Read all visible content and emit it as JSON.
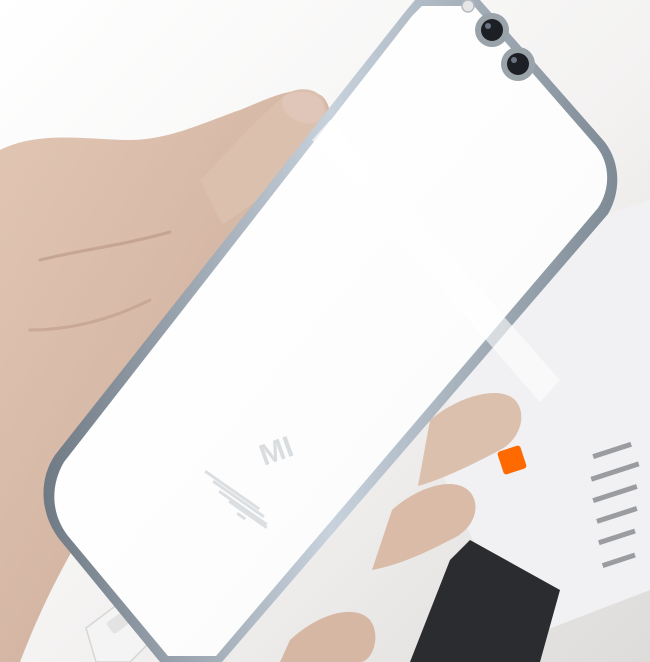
{
  "photo": {
    "subject": "phone-back-held-in-hand",
    "phone": {
      "body_color": "#fbfbfb",
      "frame_color": "#8f9aa2",
      "frame_highlight": "#c8d2dc",
      "camera_ring_color": "#9aa3aa",
      "camera_lens_color": "#1c1f24",
      "logo_text": "MI",
      "logo_color": "#d9dde0",
      "fine_print_color": "#dcdfe2"
    },
    "hand": {
      "skin_color": "#d7b9a6",
      "skin_shadow": "#b89483",
      "nail_color": "#e0c6b8"
    },
    "background": {
      "wall_color": "#e8e6e4",
      "display_card_color": "#f1f1f3",
      "brand_tag_color": "#ff6a00",
      "dark_phone_color": "#2b2c2f",
      "charger_color": "#f4f4f4"
    }
  }
}
